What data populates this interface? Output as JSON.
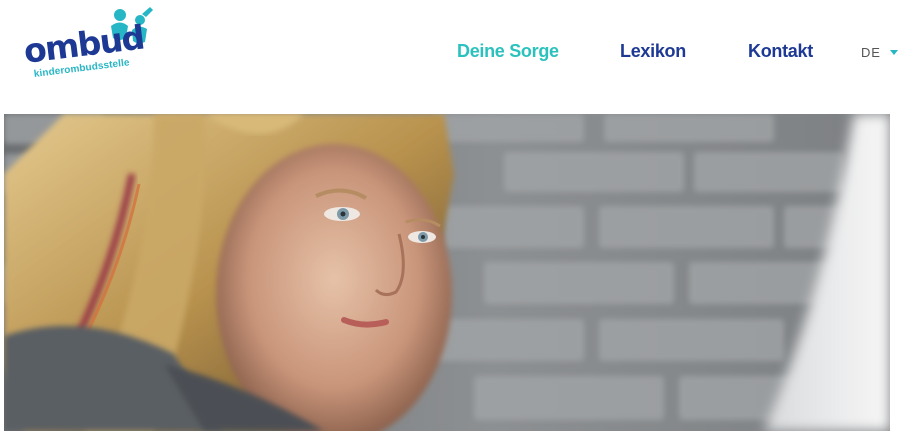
{
  "logo": {
    "wordmark": "ombud",
    "tagline": "kinderombudsstelle",
    "brand_color": "#1d3994",
    "accent_color": "#27b6c5"
  },
  "nav": {
    "items": [
      {
        "label": "Deine Sorge",
        "active": true
      },
      {
        "label": "Lexikon",
        "active": false
      },
      {
        "label": "Kontakt",
        "active": false
      }
    ]
  },
  "language": {
    "selected": "DE",
    "icon": "caret-down-icon"
  },
  "colors": {
    "nav_active": "#2bc2bd",
    "nav_default": "#1d3994"
  },
  "hero": {
    "image": "photo-girl-looking-at-laptop"
  }
}
